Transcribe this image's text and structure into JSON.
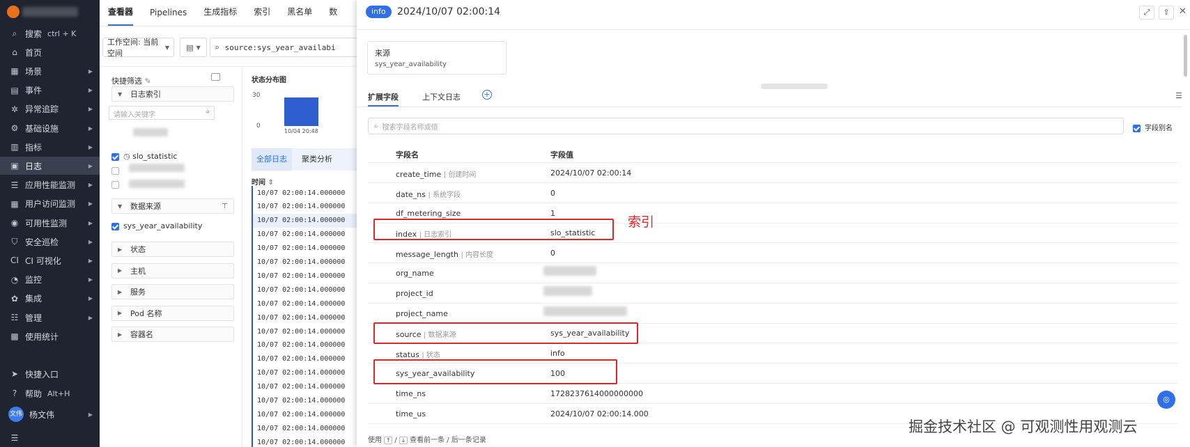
{
  "nav": {
    "items": [
      {
        "icon": "search-icon",
        "glyph": "⌕",
        "label": "搜索",
        "kbd": "ctrl + K",
        "arrow": false
      },
      {
        "icon": "home-icon",
        "glyph": "⌂",
        "label": "首页",
        "arrow": false
      },
      {
        "icon": "scene-icon",
        "glyph": "▦",
        "label": "场景",
        "arrow": true
      },
      {
        "icon": "event-icon",
        "glyph": "▤",
        "label": "事件",
        "arrow": true
      },
      {
        "icon": "anomaly-icon",
        "glyph": "✲",
        "label": "异常追踪",
        "arrow": true
      },
      {
        "icon": "infra-icon",
        "glyph": "⚙",
        "label": "基础设施",
        "arrow": true
      },
      {
        "icon": "metrics-icon",
        "glyph": "▥",
        "label": "指标",
        "arrow": true
      },
      {
        "icon": "log-icon",
        "glyph": "▣",
        "label": "日志",
        "arrow": true,
        "active": true
      },
      {
        "icon": "apm-icon",
        "glyph": "☰",
        "label": "应用性能监测",
        "arrow": true
      },
      {
        "icon": "rum-icon",
        "glyph": "▦",
        "label": "用户访问监测",
        "arrow": true
      },
      {
        "icon": "synthetic-icon",
        "glyph": "◉",
        "label": "可用性监测",
        "arrow": true
      },
      {
        "icon": "security-icon",
        "glyph": "⛉",
        "label": "安全巡检",
        "arrow": true
      },
      {
        "icon": "ci-icon",
        "glyph": "CI",
        "label": "CI 可视化",
        "arrow": true
      },
      {
        "icon": "monitor-icon",
        "glyph": "◔",
        "label": "监控",
        "arrow": true
      },
      {
        "icon": "integration-icon",
        "glyph": "✿",
        "label": "集成",
        "arrow": true
      },
      {
        "icon": "manage-icon",
        "glyph": "☷",
        "label": "管理",
        "arrow": true
      },
      {
        "icon": "usage-icon",
        "glyph": "▩",
        "label": "使用统计",
        "arrow": false
      }
    ],
    "shortcut": {
      "label": "快捷入口",
      "icon": "send-icon",
      "glyph": "➤"
    },
    "help": {
      "label": "帮助",
      "kbd": "Alt+H",
      "icon": "help-icon",
      "glyph": "?"
    },
    "user": {
      "avatar": "文伟",
      "name": "杨文伟"
    }
  },
  "tabs": [
    "查看器",
    "Pipelines",
    "生成指标",
    "索引",
    "黑名单",
    "数"
  ],
  "toolbar": {
    "workspace": "工作空间: 当前空间",
    "query": "source:sys_year_availabi"
  },
  "sidebar": {
    "title": "快捷筛选",
    "index_group": "日志索引",
    "search_placeholder": "请输入关键字",
    "index_item": "slo_statistic",
    "datasource_group": "数据来源",
    "datasource_item": "sys_year_availability",
    "groups": [
      "状态",
      "主机",
      "服务",
      "Pod 名称",
      "容器名"
    ]
  },
  "chart": {
    "title": "状态分布图",
    "ymax": "30",
    "ymin": "0",
    "xlabel": "10/04 20:48"
  },
  "log_tabs": [
    "全部日志",
    "聚类分析"
  ],
  "log_header": "时间",
  "log_rows": [
    "10/07 02:00:14.000000",
    "10/07 02:00:14.000000",
    "10/07 02:00:14.000000",
    "10/07 02:00:14.000000",
    "10/07 02:00:14.000000",
    "10/07 02:00:14.000000",
    "10/07 02:00:14.000000",
    "10/07 02:00:14.000000",
    "10/07 02:00:14.000000",
    "10/07 02:00:14.000000",
    "10/07 02:00:14.000000",
    "10/07 02:00:14.000000",
    "10/07 02:00:14.000000",
    "10/07 02:00:14.000000",
    "10/07 02:00:14.000000",
    "10/07 02:00:14.000000",
    "10/07 02:00:14.000000",
    "10/07 02:00:14.000000",
    "10/07 02:00:14.000000",
    "10/07 02:00:14.000000"
  ],
  "detail": {
    "badge": "info",
    "time": "2024/10/07 02:00:14",
    "source_label": "来源",
    "source_value": "sys_year_availability",
    "tabs": [
      "扩展字段",
      "上下文日志"
    ],
    "search_placeholder": "搜索字段名称或值",
    "alias_toggle": "字段别名",
    "col_name": "字段名",
    "col_value": "字段值",
    "rows": [
      {
        "name": "create_time",
        "alias": "创建时间",
        "value": "2024/10/07 02:00:14"
      },
      {
        "name": "date_ns",
        "alias": "系统字段",
        "value": "0"
      },
      {
        "name": "df_metering_size",
        "alias": "",
        "value": "1"
      },
      {
        "name": "index",
        "alias": "日志索引",
        "value": "slo_statistic"
      },
      {
        "name": "message_length",
        "alias": "内容长度",
        "value": "0"
      },
      {
        "name": "org_name",
        "alias": "",
        "value": ""
      },
      {
        "name": "project_id",
        "alias": "",
        "value": ""
      },
      {
        "name": "project_name",
        "alias": "",
        "value": ""
      },
      {
        "name": "source",
        "alias": "数据来源",
        "value": "sys_year_availability"
      },
      {
        "name": "status",
        "alias": "状态",
        "value": "info"
      },
      {
        "name": "sys_year_availability",
        "alias": "",
        "value": "100"
      },
      {
        "name": "time_ns",
        "alias": "",
        "value": "1728237614000000000"
      },
      {
        "name": "time_us",
        "alias": "",
        "value": "2024/10/07 02:00:14.000"
      }
    ],
    "footer_prefix": "使用",
    "footer_suffix": "查看前一条 / 后一条记录",
    "annotation": "索引"
  },
  "watermark": "掘金技术社区 @ 可观测性用观测云",
  "colors": {
    "accent": "#2f6fe8",
    "nav_bg": "#1f2430",
    "highlight": "#e0262a"
  }
}
